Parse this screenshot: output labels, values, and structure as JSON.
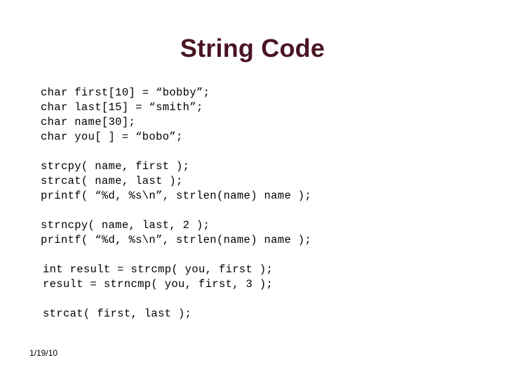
{
  "slide": {
    "title": "String Code",
    "title_color": "#4a1522",
    "background_color": "#ffffff",
    "text_color": "#000000"
  },
  "code_blocks": [
    {
      "id": "declarations",
      "indent": 0,
      "lines": [
        "char first[10] = “bobby”;",
        "char last[15] = “smith”;",
        "char name[30];",
        "char you[ ] = “bobo”;"
      ]
    },
    {
      "id": "copy-concat-print",
      "indent": 0,
      "lines": [
        "strcpy( name, first );",
        "strcat( name, last );",
        "printf( “%d, %s\\n”, strlen(name) name );"
      ]
    },
    {
      "id": "strncpy-print",
      "indent": 0,
      "lines": [
        "strncpy( name, last, 2 );",
        "printf( “%d, %s\\n”, strlen(name) name );"
      ]
    },
    {
      "id": "compare",
      "indent": 1,
      "lines": [
        "int result = strcmp( you, first );",
        "result = strncmp( you, first, 3 );"
      ]
    },
    {
      "id": "final-concat",
      "indent": 1,
      "lines": [
        "strcat( first, last );"
      ]
    }
  ],
  "footer": {
    "date": "1/19/10"
  }
}
